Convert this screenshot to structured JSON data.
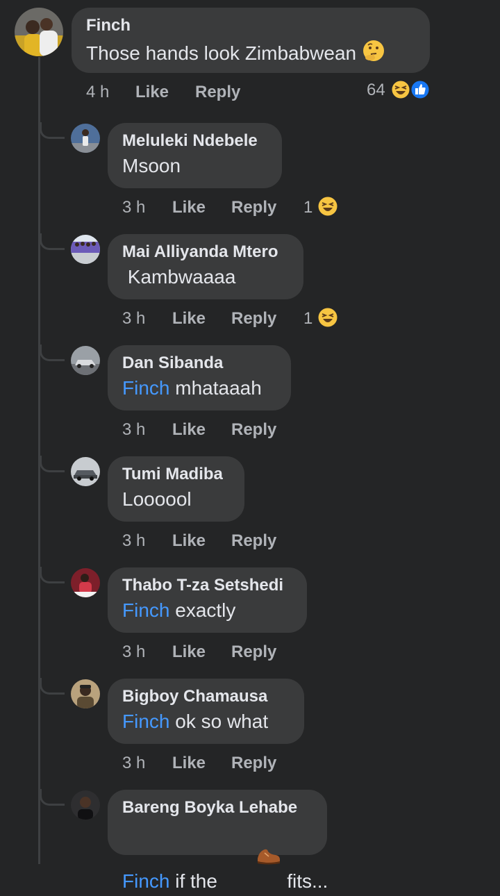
{
  "comments": [
    {
      "author": "Finch",
      "mention": "",
      "text": "Those hands look Zimbabwean",
      "time": "4 h",
      "like_label": "Like",
      "reply_label": "Reply",
      "reaction_count": "64",
      "reactions": [
        "haha-icon",
        "like-icon"
      ],
      "text_emoji": "thinking-face-icon"
    },
    {
      "author": "Meluleki Ndebele",
      "mention": "",
      "text": "Msoon",
      "time": "3 h",
      "like_label": "Like",
      "reply_label": "Reply",
      "reaction_count": "1",
      "reactions": [
        "haha-icon"
      ]
    },
    {
      "author": "Mai Alliyanda Mtero",
      "mention": "",
      "text": " Kambwaaaa",
      "time": "3 h",
      "like_label": "Like",
      "reply_label": "Reply",
      "reaction_count": "1",
      "reactions": [
        "haha-icon"
      ]
    },
    {
      "author": "Dan Sibanda",
      "mention": "Finch",
      "text": " mhataaah",
      "time": "3 h",
      "like_label": "Like",
      "reply_label": "Reply"
    },
    {
      "author": "Tumi Madiba",
      "mention": "",
      "text": "Loooool",
      "time": "3 h",
      "like_label": "Like",
      "reply_label": "Reply"
    },
    {
      "author": "Thabo T-za Setshedi",
      "mention": "Finch",
      "text": " exactly",
      "time": "3 h",
      "like_label": "Like",
      "reply_label": "Reply"
    },
    {
      "author": "Bigboy Chamausa",
      "mention": "Finch",
      "text": " ok so what",
      "time": "3 h",
      "like_label": "Like",
      "reply_label": "Reply"
    },
    {
      "author": "Bareng Boyka Lehabe",
      "mention": "Finch",
      "text_before_emoji": " if the ",
      "text_after_emoji": " fits...",
      "text_emoji": "shoe-icon"
    }
  ],
  "colors": {
    "background": "#242526",
    "bubble": "#3a3b3c",
    "mention": "#4599ff",
    "secondary_text": "#b0b3b8",
    "like_blue": "#1877f2",
    "emoji_yellow": "#f7c542"
  }
}
